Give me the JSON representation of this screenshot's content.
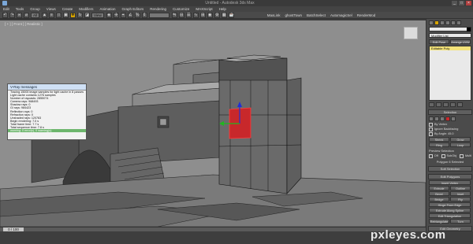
{
  "window": {
    "title": "Untitled - Autodesk 3ds Max"
  },
  "menubar": {
    "items": [
      "Edit",
      "Tools",
      "Group",
      "Views",
      "Create",
      "Modifiers",
      "Animation",
      "Graph Editors",
      "Rendering",
      "Customize",
      "MAXScript",
      "Help"
    ]
  },
  "toolbar": {
    "all_filter": "All",
    "view_dropdown": "View",
    "create_selection_set": "",
    "right_labels": [
      "MaxLink",
      "ghostTown",
      "BatchSelect",
      "AutomagicSel",
      "RenderMod"
    ]
  },
  "viewport": {
    "label": "[ + ] [ Front ] [ Realistic ]"
  },
  "vray_window": {
    "title": "V-Ray messages",
    "lines": [
      "Tracing 15000 image samples for light cache in 8 passes",
      "Light cache contains 1276 samples",
      "Number of raycasts: 2855074",
      "  Camera rays: 968493",
      "  Shadow rays: 0",
      "  GI rays: 984423",
      "  Reflection rays: 0",
      "  Refraction rays: 0",
      "  Unshaded rays: 120783",
      "Begin rendering: 7.0 s",
      "Total frame time: 7.7 s",
      "Total sequence time: 7.8 s"
    ],
    "highlight_line": "warning: 0 error(s), 0 warning(s)"
  },
  "command_panel": {
    "tabs": [
      "Edit Pose",
      "Arrange UVW"
    ],
    "modifier_list": "Modifier List",
    "stack_item": "Editable Poly",
    "sections": {
      "selection": "Selection",
      "soft_selection": "Soft Selection",
      "edit_polygons": "Edit Polygons"
    },
    "selection_rows": [
      "By Vertex",
      "Ignore Backfacing",
      "By Angle: 45.0"
    ],
    "shrink_grow": [
      "Shrink",
      "Grow"
    ],
    "ring_loop": [
      "Ring",
      "Loop"
    ],
    "preview_selection": "Preview Selection",
    "preview_options": [
      "Off",
      "SubObj",
      "Multi"
    ],
    "polygons_selected": "Polygon 6 Selected",
    "edit_buttons": [
      [
        "Insert Vertex"
      ],
      [
        "Extrude",
        "Outline"
      ],
      [
        "Bevel",
        "Inset"
      ],
      [
        "Bridge",
        "Flip"
      ],
      [
        "Hinge From Edge"
      ],
      [
        "Extrude Along Spline"
      ],
      [
        "Edit Triangulation"
      ],
      [
        "Retriangulate",
        "Turn"
      ]
    ],
    "more_sections": [
      "Edit Geometry",
      "Repeat Last"
    ]
  },
  "timeline": {
    "slider": "0 / 100"
  },
  "colors": {
    "viewport_bg": "#8e8e8e",
    "selected_polygon": "#c8282b",
    "accent": "#d7a400",
    "stack_highlight": "#f4e37a"
  },
  "watermark": {
    "text": "pxleyes.com"
  }
}
